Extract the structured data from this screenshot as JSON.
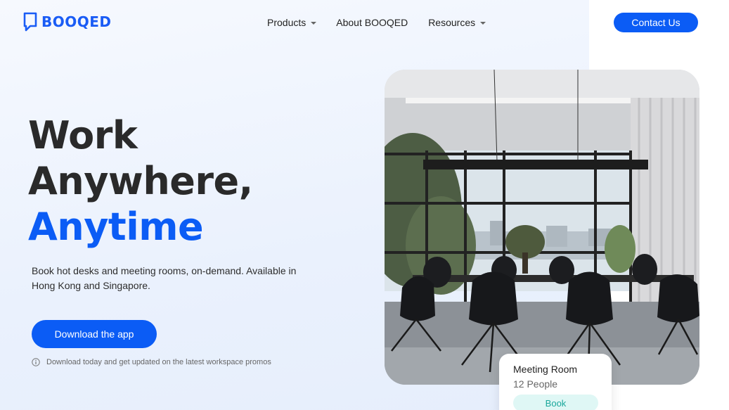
{
  "header": {
    "logo_text": "BOOQED",
    "nav": [
      {
        "label": "Products",
        "has_dropdown": true
      },
      {
        "label": "About BOOQED",
        "has_dropdown": false
      },
      {
        "label": "Resources",
        "has_dropdown": true
      }
    ],
    "contact_label": "Contact Us"
  },
  "hero": {
    "title_line1": "Work",
    "title_line2": "Anywhere,",
    "title_accent": "Anytime",
    "description": "Book hot desks and meeting rooms, on-demand. Available in Hong Kong and Singapore.",
    "cta_label": "Download the app",
    "note": "Download today and get updated on the latest workspace promos"
  },
  "room_card": {
    "name": "Meeting Room",
    "capacity": "12 People",
    "book_label": "Book"
  },
  "colors": {
    "brand": "#0b5cf5",
    "book_bg": "#dff7f5",
    "book_text": "#1aa79b"
  },
  "icons": [
    "logo-icon",
    "caret-down-icon",
    "info-icon"
  ]
}
